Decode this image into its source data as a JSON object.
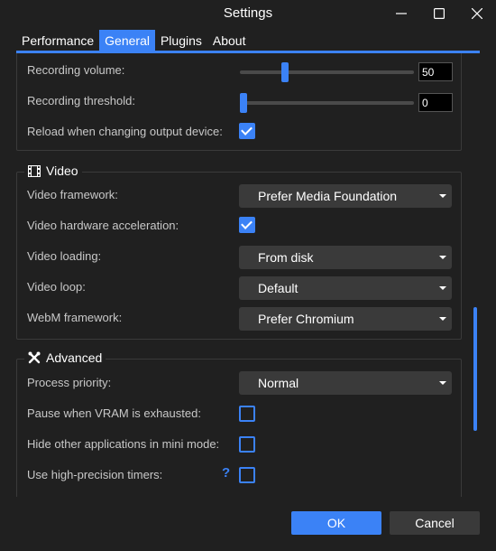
{
  "window": {
    "title": "Settings"
  },
  "tabs": [
    {
      "label": "Performance",
      "active": false
    },
    {
      "label": "General",
      "active": true
    },
    {
      "label": "Plugins",
      "active": false
    },
    {
      "label": "About",
      "active": false
    }
  ],
  "recording": {
    "volume_label": "Recording volume:",
    "volume_value": "50",
    "threshold_label": "Recording threshold:",
    "threshold_value": "0",
    "reload_label": "Reload when changing output device:",
    "reload_checked": true
  },
  "video": {
    "title": "Video",
    "framework_label": "Video framework:",
    "framework_value": "Prefer Media Foundation",
    "hwaccel_label": "Video hardware acceleration:",
    "hwaccel_checked": true,
    "loading_label": "Video loading:",
    "loading_value": "From disk",
    "loop_label": "Video loop:",
    "loop_value": "Default",
    "webm_label": "WebM framework:",
    "webm_value": "Prefer Chromium"
  },
  "advanced": {
    "title": "Advanced",
    "priority_label": "Process priority:",
    "priority_value": "Normal",
    "vram_label": "Pause when VRAM is exhausted:",
    "vram_checked": false,
    "hide_label": "Hide other applications in mini mode:",
    "hide_checked": false,
    "timers_label": "Use high-precision timers:",
    "timers_checked": false,
    "help_glyph": "?"
  },
  "footer": {
    "ok_label": "OK",
    "cancel_label": "Cancel"
  },
  "colors": {
    "accent": "#3b82f6",
    "background": "#202020"
  }
}
